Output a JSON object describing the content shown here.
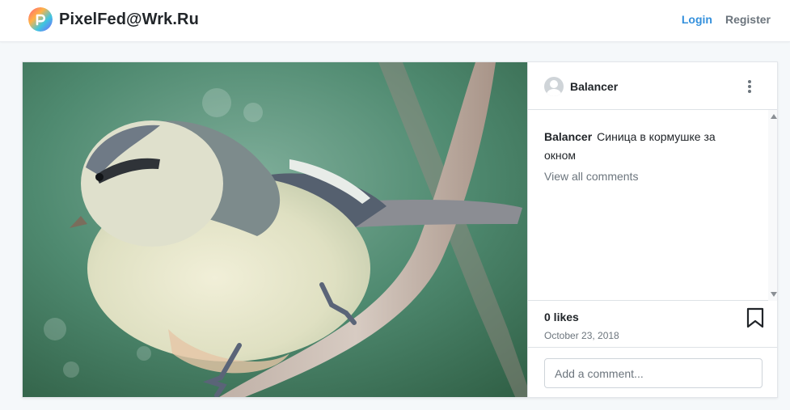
{
  "navbar": {
    "brand": "PixelFed@Wrk.Ru",
    "login": "Login",
    "register": "Register",
    "logo_icon": "pixelfed-logo-icon"
  },
  "post": {
    "author": "Balancer",
    "caption_author": "Balancer",
    "caption": "Синица в кормушке за окном",
    "view_all_comments": "View all comments",
    "likes": "0 likes",
    "date": "October 23, 2018",
    "comment_placeholder": "Add a comment...",
    "image": "blue-tit-on-branch-photo"
  },
  "icons": {
    "more": "more-vertical-icon",
    "bookmark": "bookmark-icon",
    "avatar": "default-avatar-icon"
  },
  "colors": {
    "accent": "#3490dc",
    "muted": "#6c757d",
    "background": "#f5f8fa"
  }
}
